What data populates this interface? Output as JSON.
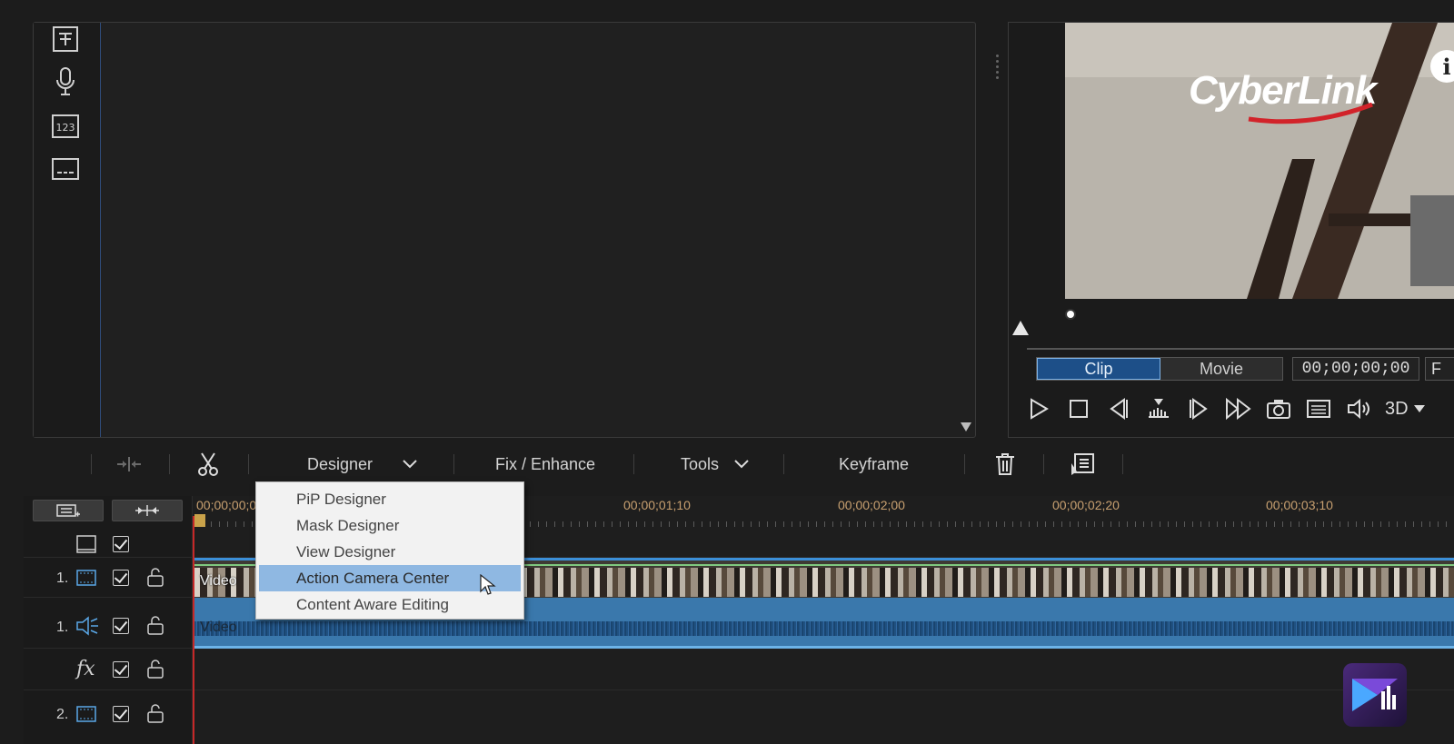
{
  "library": {
    "tools": [
      "title-designer-icon",
      "microphone-icon",
      "chapter-numbers-icon",
      "subtitle-icon"
    ]
  },
  "preview": {
    "logo_text": "CyberLink",
    "info_label": "i",
    "modes": {
      "clip": "Clip",
      "movie": "Movie",
      "active": "Clip"
    },
    "timecode": "00;00;00;00",
    "timecode_extra": "F",
    "btn_3d": "3D"
  },
  "toolbar": {
    "designer": "Designer",
    "fix_enhance": "Fix / Enhance",
    "tools": "Tools",
    "keyframe": "Keyframe"
  },
  "designer_menu": {
    "items": [
      "PiP Designer",
      "Mask Designer",
      "View Designer",
      "Action Camera Center",
      "Content Aware Editing"
    ],
    "highlighted": "Action Camera Center"
  },
  "timeline": {
    "ruler_labels": [
      "00;00;00;00",
      "00;00;01;10",
      "00;00;02;00",
      "00;00;02;20",
      "00;00;03;10"
    ],
    "tracks": [
      {
        "num": "",
        "type": "video-master"
      },
      {
        "num": "1.",
        "type": "video"
      },
      {
        "num": "1.",
        "type": "audio"
      },
      {
        "num": "",
        "type": "fx",
        "label": "fx"
      },
      {
        "num": "2.",
        "type": "video"
      }
    ],
    "video_clip_label": "Video",
    "audio_clip_label": "Video"
  },
  "colors": {
    "accent_blue": "#3b8fd9",
    "playhead_red": "#c62828",
    "menu_highlight": "#8fb8e2",
    "ruler_text": "#c8a070"
  }
}
